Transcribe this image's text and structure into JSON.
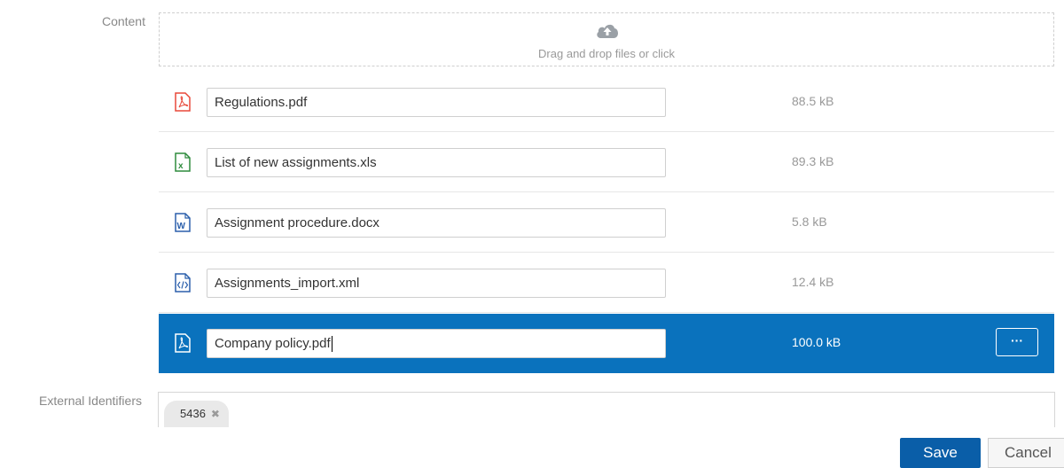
{
  "content_label": "Content",
  "dropzone": {
    "hint": "Drag and drop files or click",
    "icon": "cloud-upload-icon"
  },
  "files": [
    {
      "name": "Regulations.pdf",
      "size": "88.5 kB",
      "icon": "pdf-file-icon",
      "color": "#e8493a"
    },
    {
      "name": "List of new assignments.xls",
      "size": "89.3 kB",
      "icon": "excel-file-icon",
      "color": "#2e8b3d"
    },
    {
      "name": "Assignment procedure.docx",
      "size": "5.8 kB",
      "icon": "word-file-icon",
      "color": "#2b5fab"
    },
    {
      "name": "Assignments_import.xml",
      "size": "12.4 kB",
      "icon": "xml-file-icon",
      "color": "#2b5fab"
    },
    {
      "name": "Company policy.pdf",
      "size": "100.0 kB",
      "icon": "pdf-file-icon",
      "color": "#ffffff",
      "selected": true
    }
  ],
  "more_button": "···",
  "external_identifiers": {
    "label": "External Identifiers",
    "tags": [
      "5436"
    ]
  },
  "actions": {
    "save": "Save",
    "cancel": "Cancel"
  },
  "colors": {
    "selected_row": "#0a72bd",
    "save_button": "#0a5ea8"
  }
}
